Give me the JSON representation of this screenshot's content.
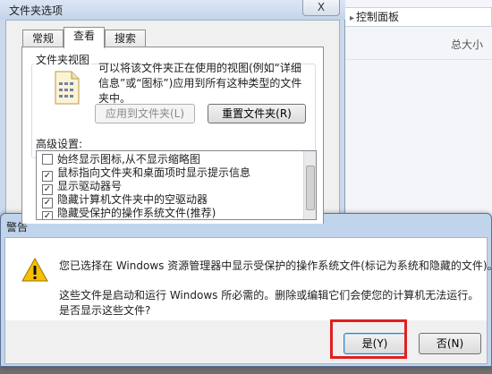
{
  "background_window": {
    "breadcrumb": "控制面板",
    "column_header": "总大小"
  },
  "folder_options": {
    "title": "文件夹选项",
    "close_label": "X",
    "tabs": [
      {
        "label": "常规",
        "active": false
      },
      {
        "label": "查看",
        "active": true
      },
      {
        "label": "搜索",
        "active": false
      }
    ],
    "folder_view": {
      "group_label": "文件夹视图",
      "description": "可以将该文件夹正在使用的视图(例如“详细信息”或“图标”)应用到所有这种类型的文件夹中。",
      "apply_button": "应用到文件夹(L)",
      "reset_button": "重置文件夹(R)"
    },
    "advanced": {
      "label": "高级设置:",
      "items": [
        {
          "label": "始终显示图标,从不显示缩略图",
          "checked": false
        },
        {
          "label": "鼠标指向文件夹和桌面项时显示提示信息",
          "checked": true
        },
        {
          "label": "显示驱动器号",
          "checked": true
        },
        {
          "label": "隐藏计算机文件夹中的空驱动器",
          "checked": true
        },
        {
          "label": "隐藏受保护的操作系统文件(推荐)",
          "checked": true
        }
      ]
    }
  },
  "warning_dialog": {
    "title": "警告",
    "icon": "warning-triangle-icon",
    "message_line1": "您已选择在 Windows 资源管理器中显示受保护的操作系统文件(标记为系统和隐藏的文件)。",
    "message_line2": "这些文件是启动和运行 Windows 所必需的。删除或编辑它们会使您的计算机无法运行。",
    "message_line3": "是否显示这些文件?",
    "yes_button": "是(Y)",
    "no_button": "否(N)",
    "highlight_color": "#e02020"
  }
}
